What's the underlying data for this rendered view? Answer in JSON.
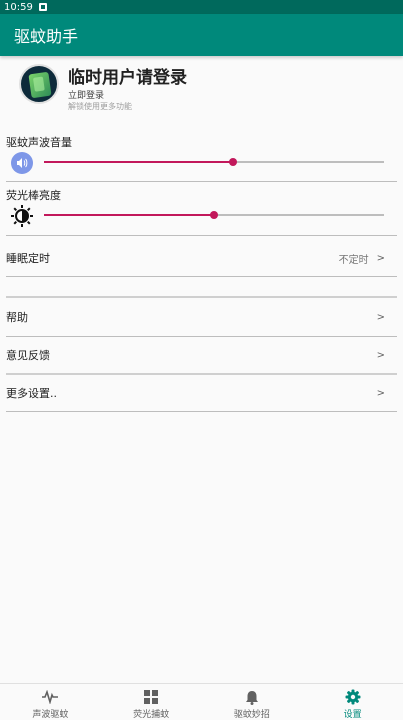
{
  "status_bar": {
    "time": "10:59",
    "notification_icon": "notification-icon"
  },
  "app_bar": {
    "title": "驱蚊助手"
  },
  "profile": {
    "title": "临时用户请登录",
    "login_link": "立即登录",
    "hint": "解锁使用更多功能",
    "avatar_icon": "app-avatar-icon"
  },
  "volume": {
    "label": "驱蚊声波音量",
    "icon": "speaker-icon",
    "value_fraction": 0.555
  },
  "brightness": {
    "label": "荧光棒亮度",
    "icon": "brightness-icon",
    "value_fraction": 0.5
  },
  "menu": {
    "sleep_timer": {
      "label": "睡眠定时",
      "value": "不定时",
      "chevron": ">"
    },
    "help": {
      "label": "帮助",
      "chevron": ">"
    },
    "feedback": {
      "label": "意见反馈",
      "chevron": ">"
    },
    "more_settings": {
      "label": "更多设置..",
      "chevron": ">"
    }
  },
  "bottom_nav": [
    {
      "label": "声波驱蚊",
      "icon": "waveform-icon",
      "active": false
    },
    {
      "label": "荧光捕蚊",
      "icon": "grid-icon",
      "active": false
    },
    {
      "label": "驱蚊妙招",
      "icon": "bell-icon",
      "active": false
    },
    {
      "label": "设置",
      "icon": "gear-icon",
      "active": true
    }
  ],
  "colors": {
    "primary": "#00897b",
    "primary_dark": "#00695c",
    "accent": "#c2185b",
    "speaker_bg": "#7e97e8"
  }
}
